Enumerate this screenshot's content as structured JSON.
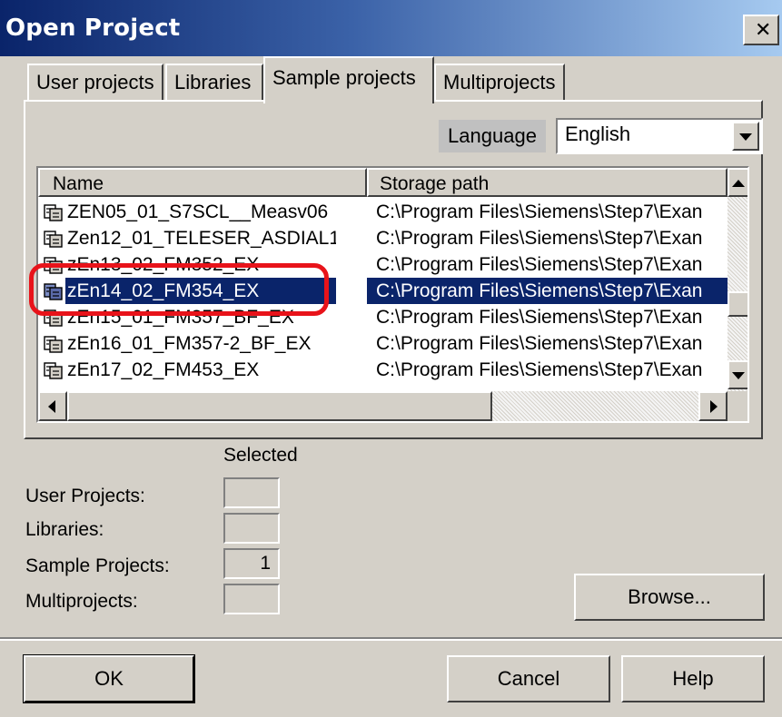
{
  "window": {
    "title": "Open Project"
  },
  "tabs": [
    {
      "label": "User projects",
      "active": false
    },
    {
      "label": "Libraries",
      "active": false
    },
    {
      "label": "Sample projects",
      "active": true
    },
    {
      "label": "Multiprojects",
      "active": false
    }
  ],
  "language": {
    "label": "Language",
    "value": "English"
  },
  "list": {
    "columns": [
      {
        "label": "Name"
      },
      {
        "label": "Storage path"
      }
    ],
    "rows": [
      {
        "name": "ZEN05_01_S7SCL__Measv06",
        "path": "C:\\Program Files\\Siemens\\Step7\\Exan",
        "selected": false
      },
      {
        "name": "Zen12_01_TELESER_ASDIAL1",
        "path": "C:\\Program Files\\Siemens\\Step7\\Exan",
        "selected": false
      },
      {
        "name": "zEn13_02_FM352_EX",
        "path": "C:\\Program Files\\Siemens\\Step7\\Exan",
        "selected": false
      },
      {
        "name": "zEn14_02_FM354_EX",
        "path": "C:\\Program Files\\Siemens\\Step7\\Exan",
        "selected": true
      },
      {
        "name": "zEn15_01_FM357_BF_EX",
        "path": "C:\\Program Files\\Siemens\\Step7\\Exan",
        "selected": false
      },
      {
        "name": "zEn16_01_FM357-2_BF_EX",
        "path": "C:\\Program Files\\Siemens\\Step7\\Exan",
        "selected": false
      },
      {
        "name": "zEn17_02_FM453_EX",
        "path": "C:\\Program Files\\Siemens\\Step7\\Exan",
        "selected": false
      }
    ]
  },
  "selected_section": {
    "heading": "Selected",
    "rows": [
      {
        "label": "User Projects:",
        "count": ""
      },
      {
        "label": "Libraries:",
        "count": ""
      },
      {
        "label": "Sample Projects:",
        "count": "1"
      },
      {
        "label": "Multiprojects:",
        "count": ""
      }
    ]
  },
  "buttons": {
    "browse": "Browse...",
    "ok": "OK",
    "cancel": "Cancel",
    "help": "Help"
  },
  "colors": {
    "face": "#d4d0c8",
    "selection": "#0a246a",
    "highlight_oval": "#e8131a"
  }
}
